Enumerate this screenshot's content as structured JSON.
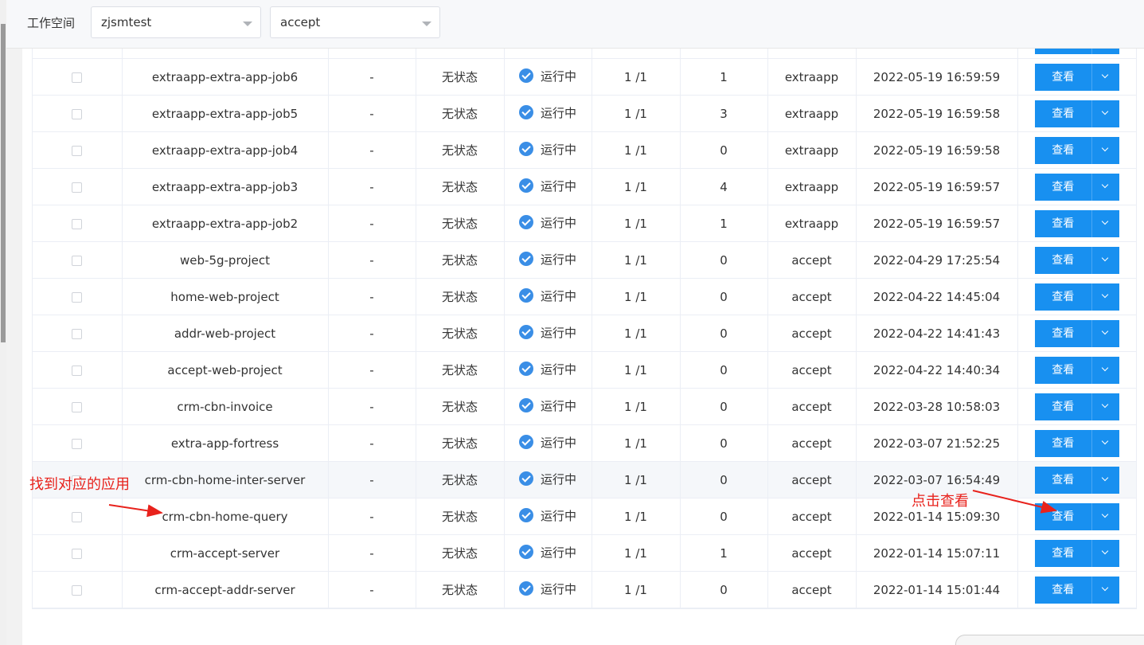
{
  "header": {
    "workspace_label": "工作空间",
    "workspace_value": "zjsmtest",
    "namespace_value": "accept"
  },
  "table": {
    "action_label": "查看",
    "rows": [
      {
        "name": "",
        "version": "",
        "state": "",
        "status": "",
        "replicas": "",
        "restarts": "",
        "namespace": "",
        "created": ""
      },
      {
        "name": "extraapp-extra-app-job6",
        "version": "-",
        "state": "无状态",
        "status": "运行中",
        "replicas": "1 /1",
        "restarts": "1",
        "namespace": "extraapp",
        "created": "2022-05-19 16:59:59"
      },
      {
        "name": "extraapp-extra-app-job5",
        "version": "-",
        "state": "无状态",
        "status": "运行中",
        "replicas": "1 /1",
        "restarts": "3",
        "namespace": "extraapp",
        "created": "2022-05-19 16:59:58"
      },
      {
        "name": "extraapp-extra-app-job4",
        "version": "-",
        "state": "无状态",
        "status": "运行中",
        "replicas": "1 /1",
        "restarts": "0",
        "namespace": "extraapp",
        "created": "2022-05-19 16:59:58"
      },
      {
        "name": "extraapp-extra-app-job3",
        "version": "-",
        "state": "无状态",
        "status": "运行中",
        "replicas": "1 /1",
        "restarts": "4",
        "namespace": "extraapp",
        "created": "2022-05-19 16:59:57"
      },
      {
        "name": "extraapp-extra-app-job2",
        "version": "-",
        "state": "无状态",
        "status": "运行中",
        "replicas": "1 /1",
        "restarts": "1",
        "namespace": "extraapp",
        "created": "2022-05-19 16:59:57"
      },
      {
        "name": "web-5g-project",
        "version": "-",
        "state": "无状态",
        "status": "运行中",
        "replicas": "1 /1",
        "restarts": "0",
        "namespace": "accept",
        "created": "2022-04-29 17:25:54"
      },
      {
        "name": "home-web-project",
        "version": "-",
        "state": "无状态",
        "status": "运行中",
        "replicas": "1 /1",
        "restarts": "0",
        "namespace": "accept",
        "created": "2022-04-22 14:45:04"
      },
      {
        "name": "addr-web-project",
        "version": "-",
        "state": "无状态",
        "status": "运行中",
        "replicas": "1 /1",
        "restarts": "0",
        "namespace": "accept",
        "created": "2022-04-22 14:41:43"
      },
      {
        "name": "accept-web-project",
        "version": "-",
        "state": "无状态",
        "status": "运行中",
        "replicas": "1 /1",
        "restarts": "0",
        "namespace": "accept",
        "created": "2022-04-22 14:40:34"
      },
      {
        "name": "crm-cbn-invoice",
        "version": "-",
        "state": "无状态",
        "status": "运行中",
        "replicas": "1 /1",
        "restarts": "0",
        "namespace": "accept",
        "created": "2022-03-28 10:58:03"
      },
      {
        "name": "extra-app-fortress",
        "version": "-",
        "state": "无状态",
        "status": "运行中",
        "replicas": "1 /1",
        "restarts": "0",
        "namespace": "accept",
        "created": "2022-03-07 21:52:25"
      },
      {
        "name": "crm-cbn-home-inter-server",
        "version": "-",
        "state": "无状态",
        "status": "运行中",
        "replicas": "1 /1",
        "restarts": "0",
        "namespace": "accept",
        "created": "2022-03-07 16:54:49"
      },
      {
        "name": "crm-cbn-home-query",
        "version": "-",
        "state": "无状态",
        "status": "运行中",
        "replicas": "1 /1",
        "restarts": "0",
        "namespace": "accept",
        "created": "2022-01-14 15:09:30"
      },
      {
        "name": "crm-accept-server",
        "version": "-",
        "state": "无状态",
        "status": "运行中",
        "replicas": "1 /1",
        "restarts": "1",
        "namespace": "accept",
        "created": "2022-01-14 15:07:11"
      },
      {
        "name": "crm-accept-addr-server",
        "version": "-",
        "state": "无状态",
        "status": "运行中",
        "replicas": "1 /1",
        "restarts": "0",
        "namespace": "accept",
        "created": "2022-01-14 15:01:44"
      }
    ]
  },
  "annotations": {
    "find_app": "找到对应的应用",
    "click_view": "点击查看"
  },
  "colors": {
    "primary_button": "#1890f0",
    "status_icon": "#3a8ee6",
    "annotation": "#e8221c"
  }
}
